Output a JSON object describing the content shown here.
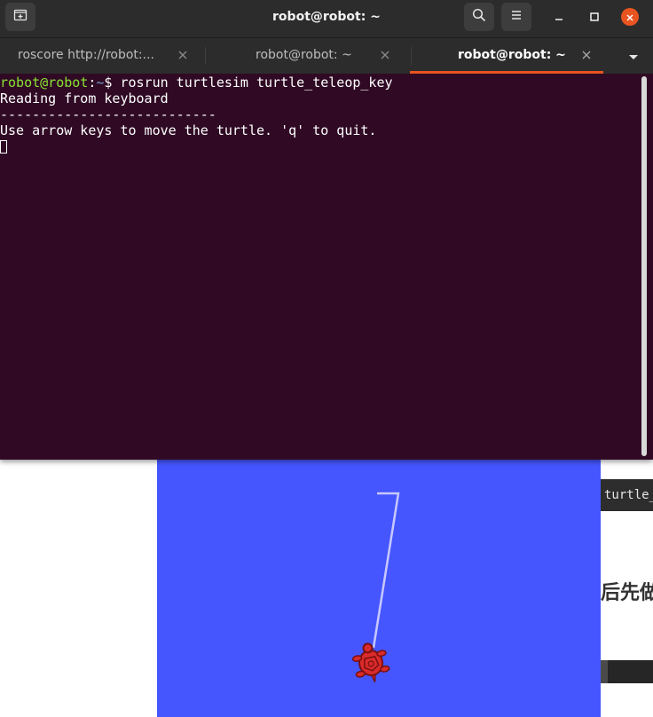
{
  "terminal": {
    "title": "robot@robot: ~",
    "tabs": [
      {
        "label": "roscore http://robot:...",
        "active": false
      },
      {
        "label": "robot@robot: ~",
        "active": false
      },
      {
        "label": "robot@robot: ~",
        "active": true
      }
    ],
    "prompt": {
      "user_host": "robot@robot",
      "colon": ":",
      "path": "~",
      "dollar": "$ ",
      "command": "rosrun turtlesim turtle_teleop_key"
    },
    "output": [
      "Reading from keyboard",
      "---------------------------",
      "Use arrow keys to move the turtle. 'q' to quit."
    ],
    "icons": {
      "new_tab": "new-tab-icon",
      "search": "search-icon",
      "menu": "hamburger-menu-icon",
      "minimize": "minimize-icon",
      "maximize": "maximize-icon",
      "close": "close-icon",
      "dropdown": "chevron-down-icon"
    },
    "colors": {
      "background": "#300a24",
      "accent": "#e95420",
      "prompt_user": "#8ae234",
      "prompt_path": "#729fcf"
    }
  },
  "background_page": {
    "code_chip_text": "turtle_",
    "cjk_text": "后先做"
  },
  "turtlesim": {
    "background_color": "#4556ff",
    "trail_color": "#c8c8ff",
    "turtle_color": "#d92b2b"
  }
}
